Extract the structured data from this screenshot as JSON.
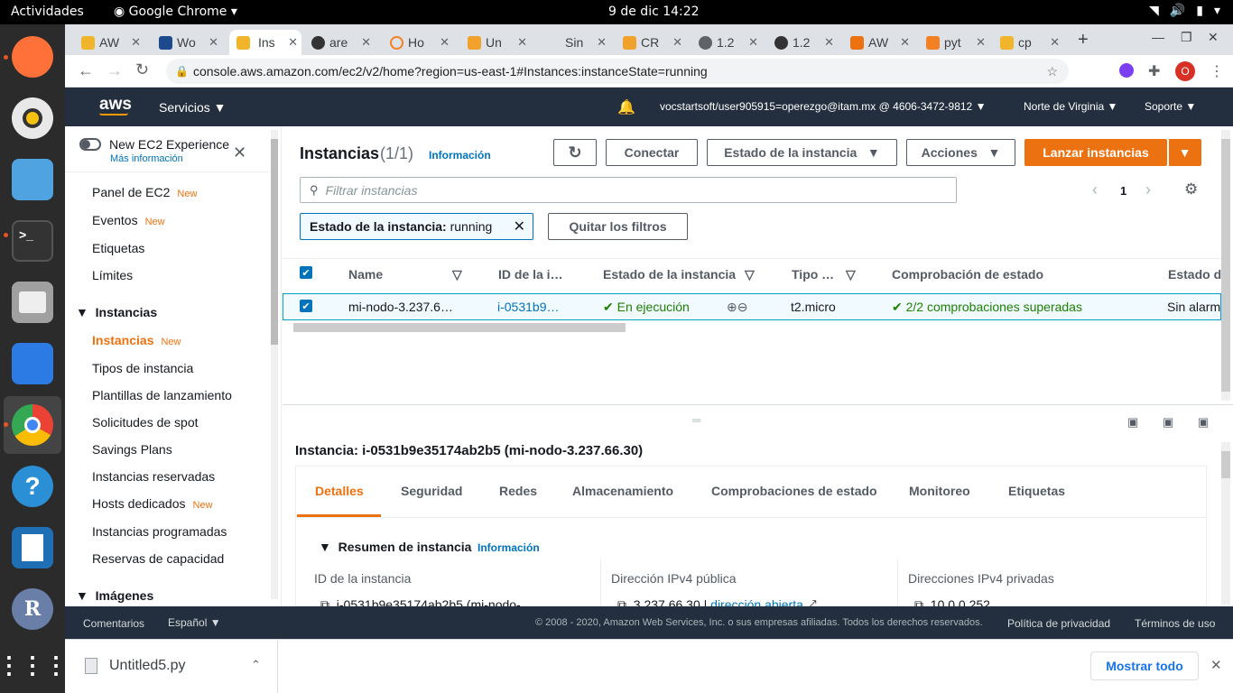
{
  "os": {
    "activities": "Actividades",
    "app": "Google Chrome",
    "clock": "9 de dic  14:22"
  },
  "browser": {
    "tabs": [
      "AW",
      "Wo",
      "Ins",
      "are",
      "Ho",
      "Un",
      "Sin",
      "CR",
      "1.2",
      "1.2",
      "AW",
      "pyt",
      "cp"
    ],
    "url": "console.aws.amazon.com/ec2/v2/home?region=us-east-1#Instances:instanceState=running",
    "profile": "O"
  },
  "aws": {
    "logo": "aws",
    "services": "Servicios",
    "account": "vocstartsoft/user905915=operezgo@itam.mx @ 4606-3472-9812",
    "region": "Norte de Virginia",
    "support": "Soporte"
  },
  "sidebar": {
    "new_exp": "New EC2 Experience",
    "more_info": "Más información",
    "items": [
      {
        "label": "Panel de EC2",
        "new": "New"
      },
      {
        "label": "Eventos",
        "new": "New"
      },
      {
        "label": "Etiquetas",
        "new": ""
      },
      {
        "label": "Límites",
        "new": ""
      }
    ],
    "section_instances": "Instancias",
    "inst_items": [
      {
        "label": "Instancias",
        "new": "New"
      },
      {
        "label": "Tipos de instancia",
        "new": ""
      },
      {
        "label": "Plantillas de lanzamiento",
        "new": ""
      },
      {
        "label": "Solicitudes de spot",
        "new": ""
      },
      {
        "label": "Savings Plans",
        "new": ""
      },
      {
        "label": "Instancias reservadas",
        "new": ""
      },
      {
        "label": "Hosts dedicados",
        "new": "New"
      },
      {
        "label": "Instancias programadas",
        "new": ""
      },
      {
        "label": "Reservas de capacidad",
        "new": ""
      }
    ],
    "section_images": "Imágenes"
  },
  "main": {
    "title": "Instancias",
    "count": "(1/1)",
    "info": "Información",
    "connect": "Conectar",
    "state_btn": "Estado de la instancia",
    "actions": "Acciones",
    "launch": "Lanzar instancias",
    "filter_placeholder": "Filtrar instancias",
    "page": "1",
    "filter_chip_key": "Estado de la instancia:",
    "filter_chip_val": "running",
    "clear_filters": "Quitar los filtros",
    "columns": [
      "Name",
      "ID de la i…",
      "Estado de la instancia",
      "Tipo …",
      "Comprobación de estado",
      "Estado d"
    ],
    "row": {
      "name": "mi-nodo-3.237.6…",
      "id": "i-0531b9…",
      "state": "En ejecución",
      "type": "t2.micro",
      "check": "2/2 comprobaciones superadas",
      "alarm": "Sin alarm"
    }
  },
  "detail": {
    "title": "Instancia: i-0531b9e35174ab2b5 (mi-nodo-3.237.66.30)",
    "tabs": [
      "Detalles",
      "Seguridad",
      "Redes",
      "Almacenamiento",
      "Comprobaciones de estado",
      "Monitoreo",
      "Etiquetas"
    ],
    "summary": "Resumen de instancia",
    "info": "Información",
    "col1": "ID de la instancia",
    "col2": "Dirección IPv4 pública",
    "col3": "Direcciones IPv4 privadas",
    "val1": "i-0531b9e35174ab2b5 (mi-nodo-",
    "val2": "3.237.66.30 |",
    "val2link": "dirección abierta",
    "val3": "10.0.0.252"
  },
  "footer": {
    "comments": "Comentarios",
    "lang": "Español",
    "copyright": "© 2008 - 2020, Amazon Web Services, Inc. o sus empresas afiliadas. Todos los derechos reservados.",
    "privacy": "Política de privacidad",
    "terms": "Términos de uso"
  },
  "download": {
    "file": "Untitled5.py",
    "show_all": "Mostrar todo"
  }
}
